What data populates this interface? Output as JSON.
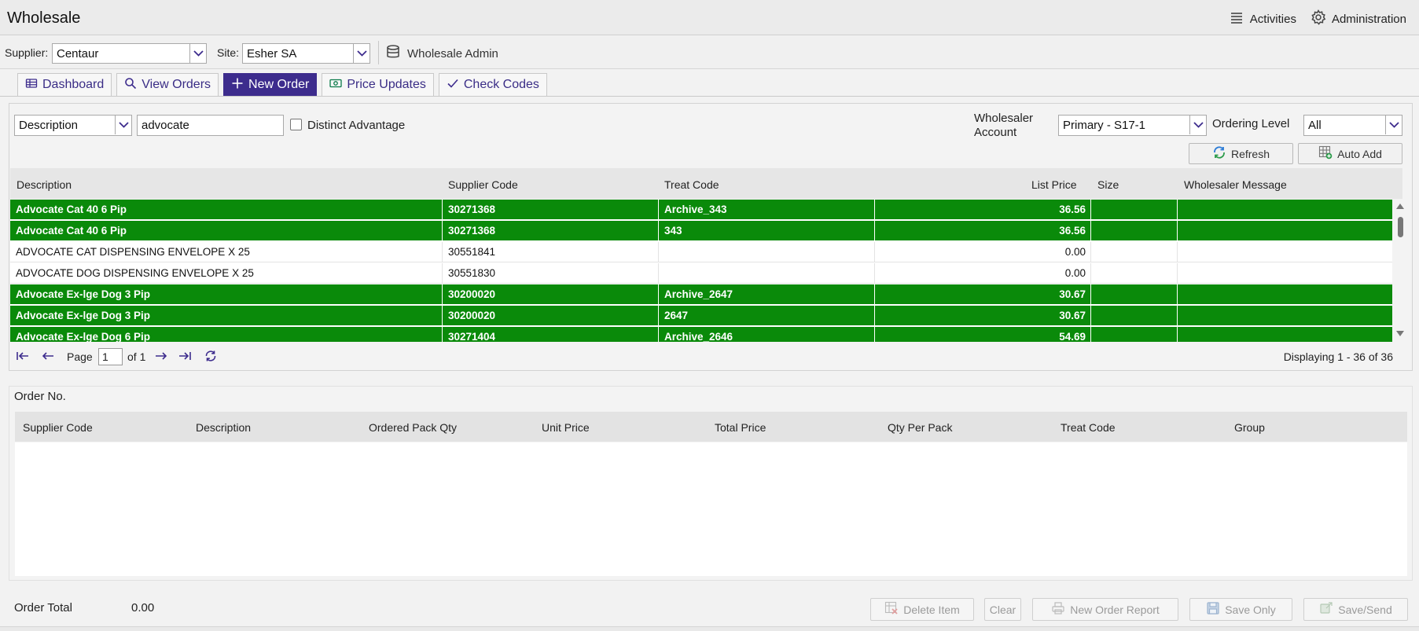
{
  "app": {
    "title": "Wholesale"
  },
  "top_nav": {
    "activities": "Activities",
    "administration": "Administration"
  },
  "filters": {
    "supplier_label": "Supplier:",
    "supplier_value": "Centaur",
    "site_label": "Site:",
    "site_value": "Esher SA",
    "admin_label": "Wholesale Admin"
  },
  "tabs": [
    {
      "label": "Dashboard",
      "icon": "table-icon",
      "active": false
    },
    {
      "label": "View Orders",
      "icon": "search-icon",
      "active": false
    },
    {
      "label": "New Order",
      "icon": "plus-icon",
      "active": true
    },
    {
      "label": "Price Updates",
      "icon": "money-icon",
      "active": false
    },
    {
      "label": "Check Codes",
      "icon": "check-icon",
      "active": false
    }
  ],
  "search": {
    "field_value": "Description",
    "query_value": "advocate",
    "distinct_label": "Distinct Advantage",
    "wholesaler_account_label_1": "Wholesaler",
    "wholesaler_account_label_2": "Account",
    "wholesaler_account_value": "Primary - S17-1",
    "ordering_level_label": "Ordering Level",
    "ordering_level_value": "All",
    "refresh_label": "Refresh",
    "auto_add_label": "Auto Add"
  },
  "grid": {
    "columns": [
      "Description",
      "Supplier Code",
      "Treat Code",
      "List Price",
      "Size",
      "Wholesaler Message"
    ],
    "rows": [
      {
        "description": "Advocate Cat 40 6 Pip",
        "supplier_code": "30271368",
        "treat_code": "Archive_343",
        "list_price": "36.56",
        "size": "",
        "message": "",
        "highlight": true
      },
      {
        "description": "Advocate Cat 40 6 Pip",
        "supplier_code": "30271368",
        "treat_code": "343",
        "list_price": "36.56",
        "size": "",
        "message": "",
        "highlight": true
      },
      {
        "description": "ADVOCATE CAT DISPENSING ENVELOPE X 25",
        "supplier_code": "30551841",
        "treat_code": "",
        "list_price": "0.00",
        "size": "",
        "message": "",
        "highlight": false
      },
      {
        "description": "ADVOCATE DOG DISPENSING ENVELOPE X 25",
        "supplier_code": "30551830",
        "treat_code": "",
        "list_price": "0.00",
        "size": "",
        "message": "",
        "highlight": false
      },
      {
        "description": "Advocate Ex-lge Dog 3 Pip",
        "supplier_code": "30200020",
        "treat_code": "Archive_2647",
        "list_price": "30.67",
        "size": "",
        "message": "",
        "highlight": true
      },
      {
        "description": "Advocate Ex-lge Dog 3 Pip",
        "supplier_code": "30200020",
        "treat_code": "2647",
        "list_price": "30.67",
        "size": "",
        "message": "",
        "highlight": true
      },
      {
        "description": "Advocate Ex-lge Dog 6 Pip",
        "supplier_code": "30271404",
        "treat_code": "Archive_2646",
        "list_price": "54.69",
        "size": "",
        "message": "",
        "highlight": true
      }
    ],
    "colors": {
      "highlight": "#0a8a0a"
    }
  },
  "pager": {
    "page_label": "Page",
    "page_value": "1",
    "of_label": "of 1",
    "displaying": "Displaying 1 - 36 of 36"
  },
  "order": {
    "order_no_label": "Order No.",
    "columns": [
      "Supplier Code",
      "Description",
      "Ordered Pack Qty",
      "Unit Price",
      "Total Price",
      "Qty Per Pack",
      "Treat Code",
      "Group"
    ],
    "total_label": "Order Total",
    "total_value": "0.00"
  },
  "actions": {
    "delete_item": "Delete Item",
    "clear": "Clear",
    "new_order_report": "New Order Report",
    "save_only": "Save Only",
    "save_send": "Save/Send"
  }
}
